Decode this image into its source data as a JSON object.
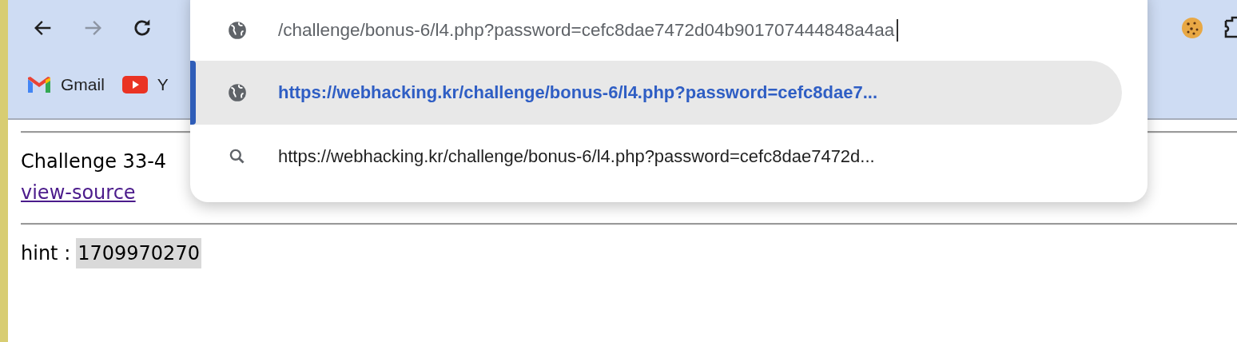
{
  "toolbar": {
    "back": {
      "disabled": false
    },
    "forward": {
      "disabled": true
    },
    "reload": {
      "disabled": false
    }
  },
  "bookmarks": [
    {
      "kind": "gmail",
      "label": "Gmail"
    },
    {
      "kind": "youtube",
      "label": "Y"
    }
  ],
  "omnibox": {
    "value": "/challenge/bonus-6/l4.php?password=cefc8dae7472d04b901707444848a4aa"
  },
  "suggestions": [
    {
      "kind": "url",
      "text": "https://webhacking.kr/challenge/bonus-6/l4.php?password=cefc8dae7...",
      "selected": true
    },
    {
      "kind": "search",
      "text": "https://webhacking.kr/challenge/bonus-6/l4.php?password=cefc8dae7472d...",
      "selected": false
    }
  ],
  "page": {
    "heading": "Challenge 33-4",
    "link": "view-source",
    "hint_label": "hint :",
    "hint_value": "1709970270",
    "hint_selected": true
  }
}
